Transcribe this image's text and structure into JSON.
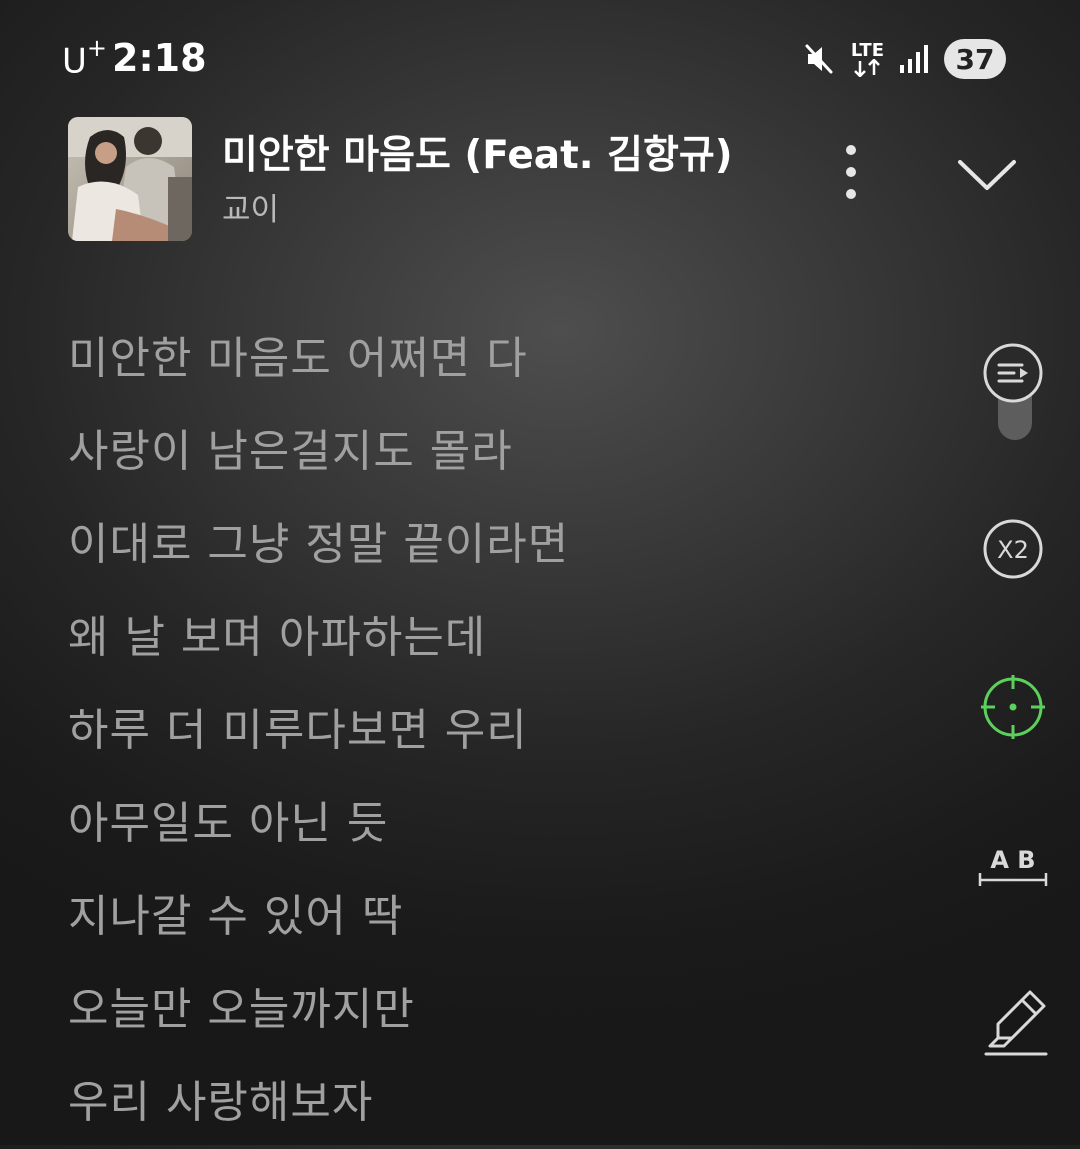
{
  "status_bar": {
    "carrier": "U",
    "carrier_sup": "+",
    "time": "2:18",
    "network": "LTE",
    "battery": "37",
    "icons": [
      "mute-icon",
      "lte-icon",
      "signal-icon",
      "battery-icon"
    ]
  },
  "track": {
    "title": "미안한 마음도 (Feat. 김항규)",
    "artist": "교이"
  },
  "lyrics": [
    "미안한 마음도 어쩌면 다",
    "사랑이 남은걸지도 몰라",
    "이대로 그냥 정말 끝이라면",
    "왜 날 보며 아파하는데",
    "하루 더 미루다보면 우리",
    "아무일도 아닌 듯",
    "지나갈 수 있어 딱",
    "오늘만 오늘까지만",
    "우리 사랑해보자"
  ],
  "controls": {
    "playlist_icon": "playlist-play-icon",
    "speed_label": "X2",
    "focus_icon": "crosshair-icon",
    "font_size_label": "A B",
    "highlight_icon": "highlighter-icon"
  },
  "colors": {
    "accent_green": "#5bd15b",
    "lyric_text": "#a0a0a0",
    "icon_stroke": "#d9d9d9"
  }
}
